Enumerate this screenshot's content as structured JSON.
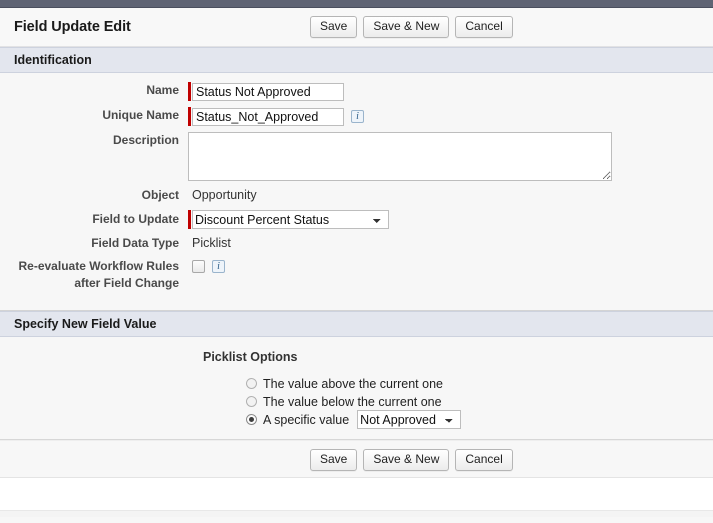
{
  "window": {
    "top_strip_color": "#5f6474"
  },
  "header": {
    "title": "Field Update Edit",
    "buttons": [
      {
        "label": "Save",
        "name": "save-button"
      },
      {
        "label": "Save & New",
        "name": "save-and-new-button"
      },
      {
        "label": "Cancel",
        "name": "cancel-button"
      }
    ]
  },
  "sections": {
    "identification": {
      "title": "Identification"
    },
    "specify_new_field_value": {
      "title": "Specify New Field Value"
    }
  },
  "fields": {
    "name": {
      "label": "Name",
      "value": "Status Not Approved",
      "placeholder": "",
      "required": true
    },
    "unique_name": {
      "label": "Unique Name",
      "value": "Status_Not_Approved",
      "placeholder": "",
      "required": true,
      "info_icon": "info-icon"
    },
    "description": {
      "label": "Description",
      "value": "",
      "placeholder": ""
    },
    "object": {
      "label": "Object",
      "value": "Opportunity"
    },
    "field_to_update": {
      "label": "Field to Update",
      "value": "Discount Percent Status",
      "required": true,
      "options": [
        "Discount Percent Status"
      ]
    },
    "field_data_type": {
      "label": "Field Data Type",
      "value": "Picklist"
    },
    "reevaluate": {
      "label_line1": "Re-evaluate Workflow Rules",
      "label_line2": "after Field Change",
      "checked": false,
      "info_icon": "info-icon"
    }
  },
  "picklist": {
    "title": "Picklist Options",
    "options": [
      {
        "label": "The value above the current one",
        "selected": false
      },
      {
        "label": "The value below the current one",
        "selected": false
      },
      {
        "label": "A specific value",
        "selected": true
      }
    ],
    "specific_value": {
      "value": "Not Approved",
      "options": [
        "Not Approved"
      ]
    }
  },
  "footer": {
    "buttons": [
      {
        "label": "Save",
        "name": "save-button-bottom"
      },
      {
        "label": "Save & New",
        "name": "save-and-new-button-bottom"
      },
      {
        "label": "Cancel",
        "name": "cancel-button-bottom"
      }
    ]
  },
  "colors": {
    "required_marker": "#c00000",
    "section_header_bg": "#e3e6ee",
    "page_bg": "#f7f7f7"
  }
}
